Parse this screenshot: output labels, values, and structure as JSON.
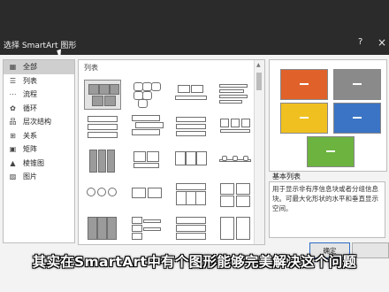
{
  "window": {
    "title": "选择 SmartArt 图形",
    "help": "?",
    "close": "×"
  },
  "categories": [
    {
      "label": "全部",
      "icon": "all-icon",
      "glyph": "▦",
      "selected": true
    },
    {
      "label": "列表",
      "icon": "list-icon",
      "glyph": "☰"
    },
    {
      "label": "流程",
      "icon": "process-icon",
      "glyph": "⋯"
    },
    {
      "label": "循环",
      "icon": "cycle-icon",
      "glyph": "✿"
    },
    {
      "label": "层次结构",
      "icon": "hierarchy-icon",
      "glyph": "品"
    },
    {
      "label": "关系",
      "icon": "relationship-icon",
      "glyph": "⊞"
    },
    {
      "label": "矩阵",
      "icon": "matrix-icon",
      "glyph": "▣"
    },
    {
      "label": "棱锥图",
      "icon": "pyramid-icon",
      "glyph": "▲"
    },
    {
      "label": "图片",
      "icon": "picture-icon",
      "glyph": "▨"
    }
  ],
  "list": {
    "header": "列表"
  },
  "preview": {
    "colors": [
      "#e0622a",
      "#8a8a8a",
      "#f0c020",
      "#3b74c4",
      "#6db33f"
    ]
  },
  "description": {
    "title": "基本列表",
    "text": "用于显示非有序信息块或者分组信息块。可最大化形状的水平和垂直显示空间。"
  },
  "buttons": {
    "ok": "确定",
    "cancel": ""
  },
  "subtitle": "其实在SmartArt中有个图形能够完美解决这个问题"
}
